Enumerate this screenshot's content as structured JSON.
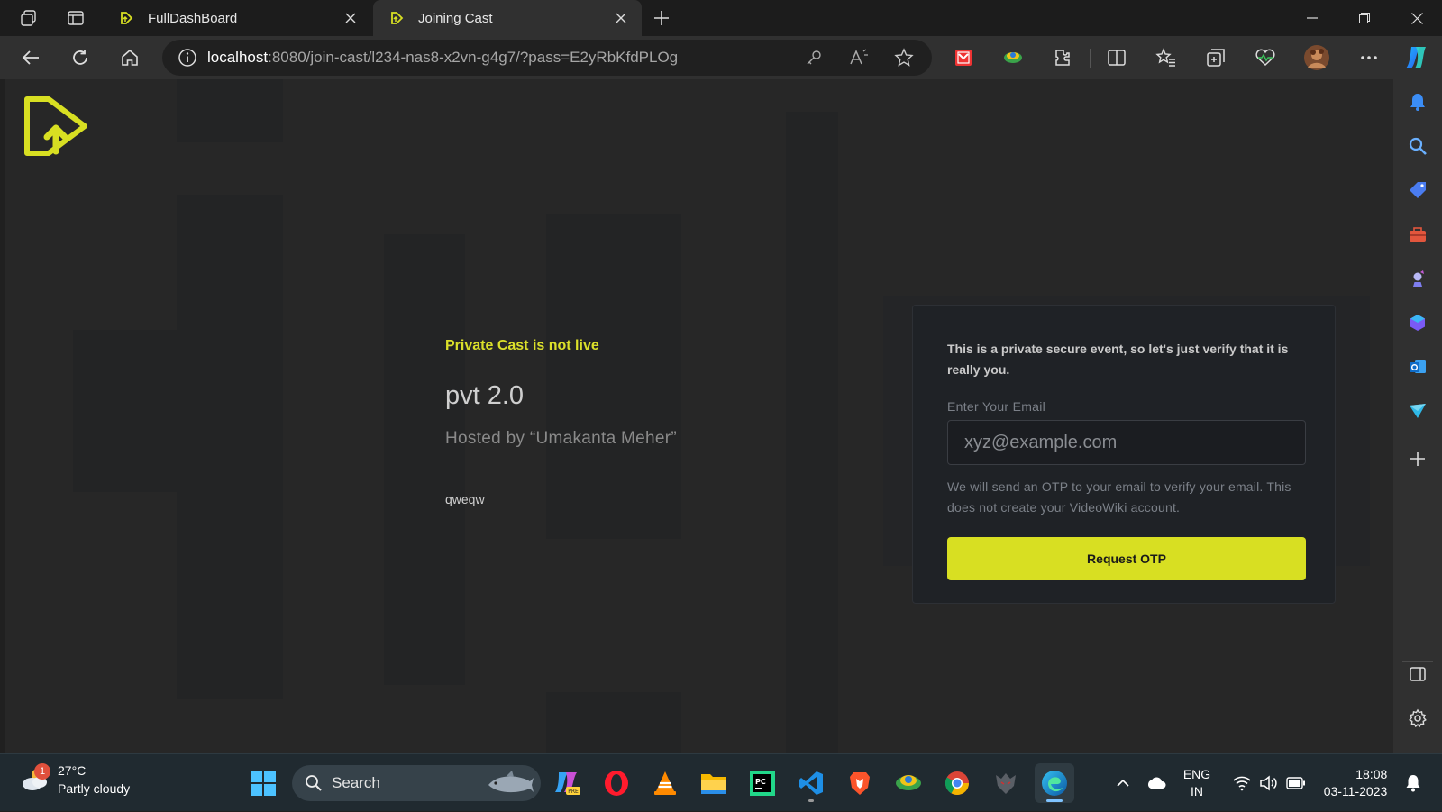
{
  "browser": {
    "tabs": [
      {
        "title": "FullDashBoard",
        "active": false
      },
      {
        "title": "Joining Cast",
        "active": true
      }
    ],
    "url_host": "localhost",
    "url_rest": ":8080/join-cast/l234-nas8-x2vn-g4g7/?pass=E2yRbKfdPLOg"
  },
  "page": {
    "cast": {
      "status": "Private Cast is not live",
      "title": "pvt 2.0",
      "host": "Hosted by “Umakanta Meher”",
      "description": "qweqw"
    },
    "verify": {
      "intro": "This is a private secure event, so let's just verify that it is really you.",
      "email_label": "Enter Your Email",
      "email_placeholder": "xyz@example.com",
      "email_value": "",
      "help": "We will send an OTP to your email to verify your email. This does not create your VideoWiki account.",
      "button": "Request OTP"
    },
    "accent_color": "#d8df22"
  },
  "taskbar": {
    "weather_temp": "27°C",
    "weather_desc": "Partly cloudy",
    "weather_badge": "1",
    "search_label": "Search",
    "lang_line1": "ENG",
    "lang_line2": "IN",
    "time": "18:08",
    "date": "03-11-2023"
  }
}
